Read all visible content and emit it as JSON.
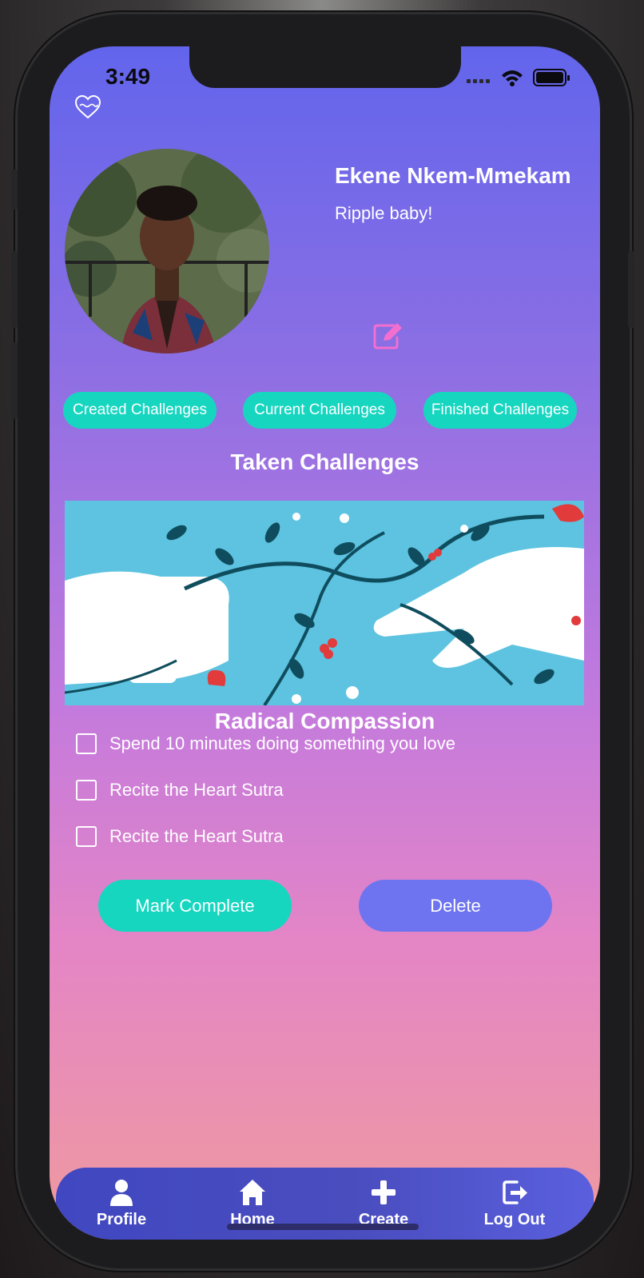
{
  "status_bar": {
    "time": "3:49"
  },
  "profile": {
    "name": "Ekene Nkem-Mmekam",
    "bio": "Ripple baby!"
  },
  "filters": [
    {
      "label": "Created Challenges"
    },
    {
      "label": "Current Challenges"
    },
    {
      "label": "Finished Challenges"
    }
  ],
  "section_title": "Taken Challenges",
  "challenge": {
    "title": "Radical Compassion",
    "tasks": [
      {
        "label": "Spend 10 minutes doing something you love",
        "checked": false
      },
      {
        "label": "Recite the Heart Sutra",
        "checked": false
      },
      {
        "label": "Recite the Heart Sutra",
        "checked": false
      }
    ],
    "mark_complete_label": "Mark Complete",
    "delete_label": "Delete"
  },
  "tabbar": {
    "items": [
      {
        "label": "Profile",
        "icon": "person-icon"
      },
      {
        "label": "Home",
        "icon": "home-icon"
      },
      {
        "label": "Create",
        "icon": "plus-icon"
      },
      {
        "label": "Log Out",
        "icon": "logout-icon"
      }
    ]
  },
  "colors": {
    "accent_teal": "#16d6c0",
    "accent_indigo": "#6e74ef",
    "edit_icon": "#f26fd0"
  }
}
